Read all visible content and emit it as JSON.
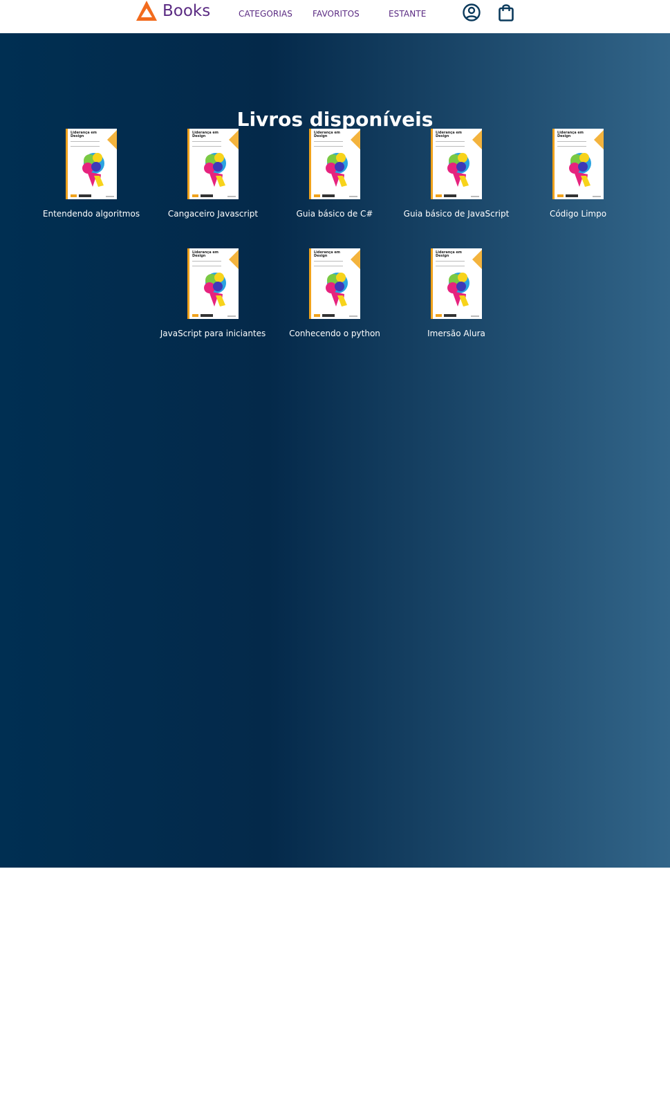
{
  "header": {
    "logo_text": "Books",
    "nav": [
      {
        "label": "CATEGORIAS"
      },
      {
        "label": "FAVORITOS"
      },
      {
        "label": "ESTANTE"
      }
    ],
    "icons": [
      "user-profile-icon",
      "shopping-bag-icon"
    ]
  },
  "main": {
    "title": "Livros disponíveis",
    "cover": {
      "title_line1": "Liderança em",
      "title_line2": "Design"
    },
    "books": [
      {
        "name": "Entendendo algoritmos"
      },
      {
        "name": "Cangaceiro Javascript"
      },
      {
        "name": "Guia básico de C#"
      },
      {
        "name": "Guia básico de JavaScript"
      },
      {
        "name": "Código Limpo"
      },
      {
        "name": "JavaScript para iniciantes"
      },
      {
        "name": "Conhecendo o python"
      },
      {
        "name": "Imersão Alura"
      }
    ]
  },
  "colors": {
    "brand_orange": "#f26b1d",
    "nav_purple": "#5a2a82",
    "gradient_start": "#002f52",
    "gradient_end": "#326589",
    "icon_navy": "#0b3a5c"
  }
}
